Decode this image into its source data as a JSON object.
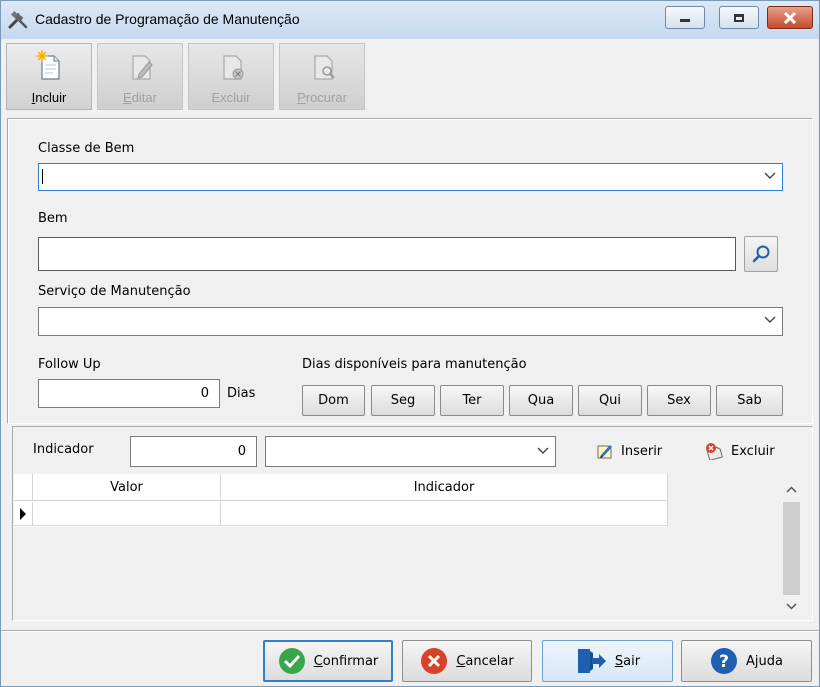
{
  "window": {
    "title": "Cadastro de Programação de Manutenção",
    "icon": "tools-icon"
  },
  "toolbar": {
    "buttons": [
      {
        "label": "Incluir",
        "icon": "new-document-icon",
        "enabled": true
      },
      {
        "label": "Editar",
        "icon": "edit-document-icon",
        "enabled": false
      },
      {
        "label": "Excluir",
        "icon": "delete-document-icon",
        "enabled": false
      },
      {
        "label": "Procurar",
        "icon": "search-document-icon",
        "enabled": false
      }
    ]
  },
  "form": {
    "classe_label": "Classe de Bem",
    "classe_value": "",
    "bem_label": "Bem",
    "bem_value": "",
    "servico_label": "Serviço de Manutenção",
    "servico_value": "",
    "followup_label": "Follow Up",
    "followup_value": "0",
    "followup_unit": "Dias",
    "dias_label": "Dias disponíveis para manutenção",
    "days": [
      "Dom",
      "Seg",
      "Ter",
      "Qua",
      "Qui",
      "Sex",
      "Sab"
    ]
  },
  "indicador": {
    "label": "Indicador",
    "value": "0",
    "select_value": "",
    "inserir_label": "Inserir",
    "excluir_label": "Excluir"
  },
  "grid": {
    "columns": [
      "Valor",
      "Indicador"
    ],
    "rows": [
      [
        "",
        ""
      ]
    ]
  },
  "footer": {
    "confirmar": "Confirmar",
    "cancelar": "Cancelar",
    "sair": "Sair",
    "ajuda": "Ajuda"
  },
  "colors": {
    "confirm_green": "#3aa64a",
    "cancel_red": "#d9412b",
    "help_blue": "#1e5fb0",
    "accent_blue": "#2f7fd0"
  }
}
